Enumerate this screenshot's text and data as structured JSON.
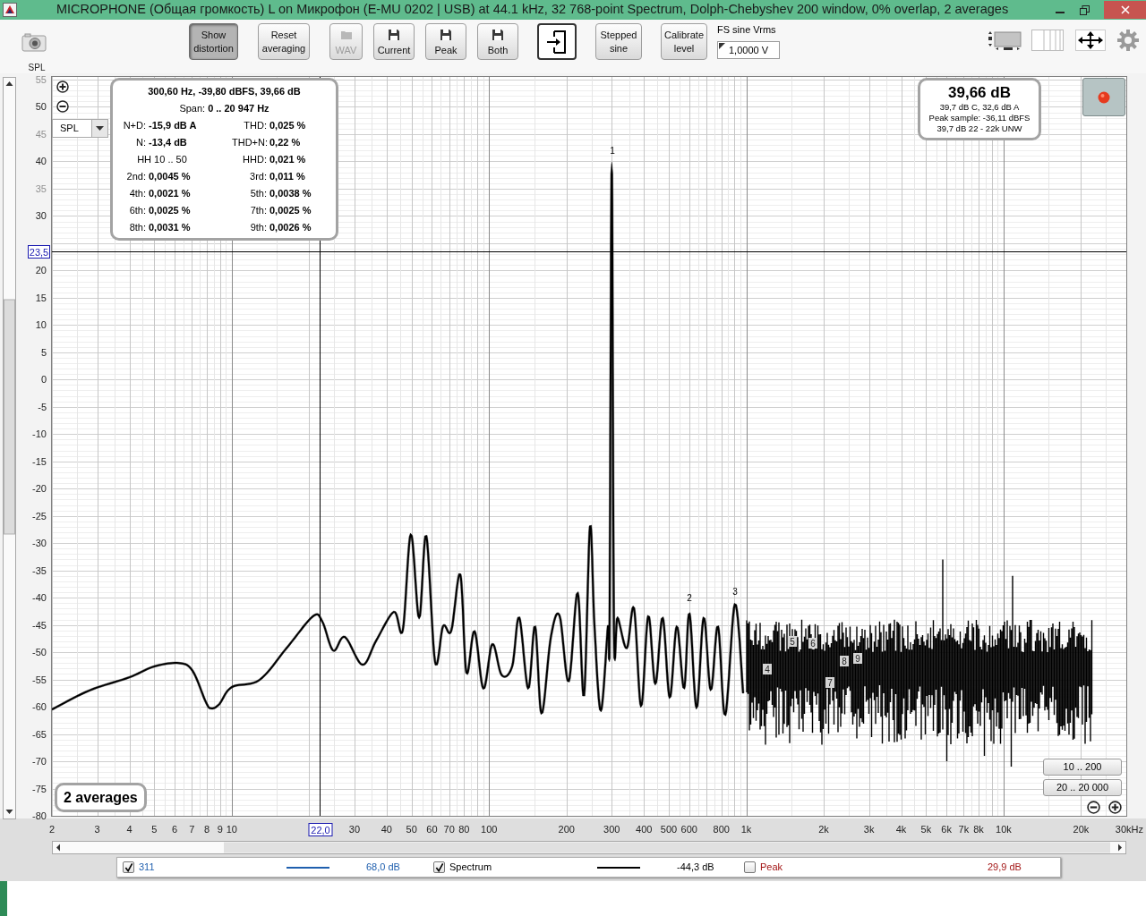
{
  "window": {
    "title": "MICROPHONE (Общая громкость) L on Микрофон (E-MU 0202 | USB) at 44.1 kHz, 32 768-point Spectrum, Dolph-Chebyshev 200 window, 0% overlap, 2 averages"
  },
  "toolbar": {
    "buttons": [
      {
        "kind": "text",
        "label": "Show distortion",
        "pressed": true,
        "disabled": false
      },
      {
        "kind": "text",
        "label": "Reset averaging",
        "pressed": false,
        "disabled": false
      },
      {
        "kind": "folder",
        "label": "WAV",
        "pressed": false,
        "disabled": true
      },
      {
        "kind": "save",
        "label": "Current",
        "pressed": false,
        "disabled": false
      },
      {
        "kind": "save",
        "label": "Peak",
        "pressed": false,
        "disabled": false
      },
      {
        "kind": "save",
        "label": "Both",
        "pressed": false,
        "disabled": false
      },
      {
        "kind": "export",
        "pressed": false,
        "disabled": false
      },
      {
        "kind": "text",
        "label": "Stepped sine",
        "pressed": false,
        "disabled": false
      },
      {
        "kind": "text",
        "label": "Calibrate level",
        "pressed": false,
        "disabled": false
      }
    ],
    "fs_field": {
      "label": "FS sine Vrms",
      "value": "1,0000 V"
    }
  },
  "graph": {
    "unit_select": "SPL",
    "info_box": {
      "header": "300,60 Hz, -39,80 dBFS, 39,66 dB",
      "span_label": "Span:",
      "span_value": "0 .. 20 947 Hz",
      "rows": [
        [
          {
            "label": "N+D:",
            "value": "-15,9 dB A"
          },
          {
            "label": "THD:",
            "value": "0,025 %"
          }
        ],
        [
          {
            "label": "N:",
            "value": "-13,4 dB"
          },
          {
            "label": "THD+N:",
            "value": "0,22 %"
          }
        ],
        [
          {
            "label": "HH 10 .. 50"
          },
          {
            "label": "HHD:",
            "value": "0,021 %"
          }
        ],
        [
          {
            "label": "2nd:",
            "value": "0,0045 %"
          },
          {
            "label": "3rd:",
            "value": "0,011 %"
          }
        ],
        [
          {
            "label": "4th:",
            "value": "0,0021 %"
          },
          {
            "label": "5th:",
            "value": "0,0038 %"
          }
        ],
        [
          {
            "label": "6th:",
            "value": "0,0025 %"
          },
          {
            "label": "7th:",
            "value": "0,0025 %"
          }
        ],
        [
          {
            "label": "8th:",
            "value": "0,0031 %"
          },
          {
            "label": "9th:",
            "value": "0,0026 %"
          }
        ]
      ]
    },
    "level_box": {
      "main": "39,66 dB",
      "lines": [
        "39,7 dB C, 32,6 dB A",
        "Peak sample: -36,11 dBFS",
        "39,7 dB 22 - 22k UNW"
      ]
    },
    "averages_label": "2 averages",
    "range_buttons": [
      "10 .. 200",
      "20 .. 20 000"
    ],
    "cursor": {
      "y_label": "23,5",
      "x_label": "22,0"
    },
    "axis_title": "SPL",
    "y_labels": [
      "55",
      "50",
      "45",
      "40",
      "35",
      "30",
      "20",
      "15",
      "10",
      "5",
      "0",
      "-5",
      "-10",
      "-15",
      "-20",
      "-25",
      "-30",
      "-35",
      "-40",
      "-45",
      "-50",
      "-55",
      "-60",
      "-65",
      "-70",
      "-75",
      "-80"
    ],
    "x_labels": [
      "2",
      "3",
      "4",
      "5",
      "6",
      "7",
      "8",
      "9",
      "10",
      "30",
      "40",
      "50",
      "60",
      "70",
      "80",
      "100",
      "200",
      "300",
      "400",
      "500",
      "600",
      "800",
      "1k",
      "2k",
      "3k",
      "4k",
      "5k",
      "6k",
      "7k",
      "8k",
      "10k",
      "20k",
      "30kHz"
    ],
    "harmonic_labels": [
      "1",
      "2",
      "3",
      "4",
      "5",
      "6",
      "7",
      "8",
      "9"
    ]
  },
  "legend": [
    {
      "label": "311",
      "checked": true,
      "color": "#1f5fae",
      "show_line": true,
      "value": "68,0 dB"
    },
    {
      "label": "Spectrum",
      "checked": true,
      "color": "#000000",
      "show_line": true,
      "value": "-44,3 dB"
    },
    {
      "label": "Peak",
      "checked": false,
      "color": "#a31515",
      "show_line": false,
      "value": "29,9 dB"
    }
  ]
}
